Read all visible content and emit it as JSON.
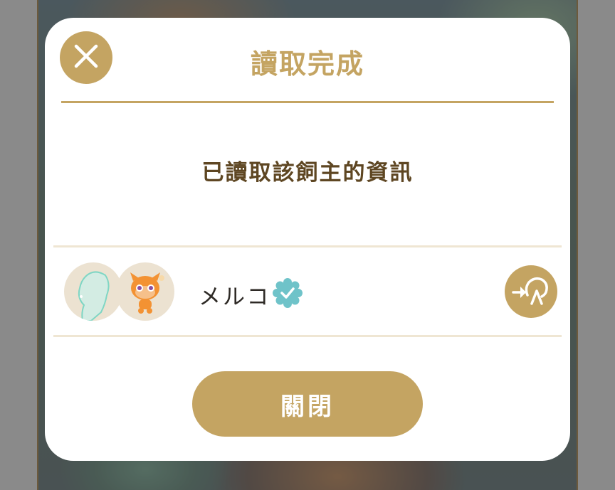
{
  "dialog": {
    "title": "讀取完成",
    "message": "已讀取該飼主的資訊",
    "close_icon": "close-icon"
  },
  "owner": {
    "name": "メルコ",
    "verified_icon": "gear-check-icon",
    "link_icon": "link-arrow-icon"
  },
  "actions": {
    "close_label": "關閉"
  },
  "colors": {
    "accent": "#c4a462",
    "title_text": "#c4a462",
    "message_text": "#5e4622",
    "name_text": "#2e2a26",
    "verified": "#6fc3c9",
    "divider": "#efe6d3"
  }
}
